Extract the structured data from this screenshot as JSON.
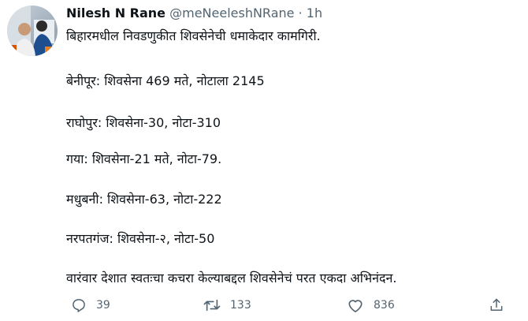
{
  "tweet": {
    "author_name": "Nilesh N Rane",
    "handle": "@meNeeleshNRane",
    "separator": "·",
    "time": "1h",
    "lines": [
      "बिहारमधील निवडणुकीत शिवसेनेची धमाकेदार कामगिरी.",
      "बेनीपूर: शिवसेना 469 मते, नोटाला 2145",
      "राघोपुर: शिवसेना-30,  नोटा-310",
      "गया: शिवसेना-21 मते,  नोटा-79.",
      "मधुबनी: शिवसेना-63,  नोटा-222",
      "नरपतगंज: शिवसेना-२, नोटा-50",
      "वारंवार देशात स्वतःचा कचरा केल्याबद्दल शिवसेनेचं परत एकदा अभिनंदन."
    ]
  },
  "actions": {
    "reply_icon": "reply-icon",
    "reply_count": "39",
    "retweet_icon": "retweet-icon",
    "retweet_count": "133",
    "like_icon": "heart-icon",
    "like_count": "836",
    "share_icon": "share-icon"
  },
  "colors": {
    "text": "#0f1419",
    "secondary": "#536471"
  }
}
